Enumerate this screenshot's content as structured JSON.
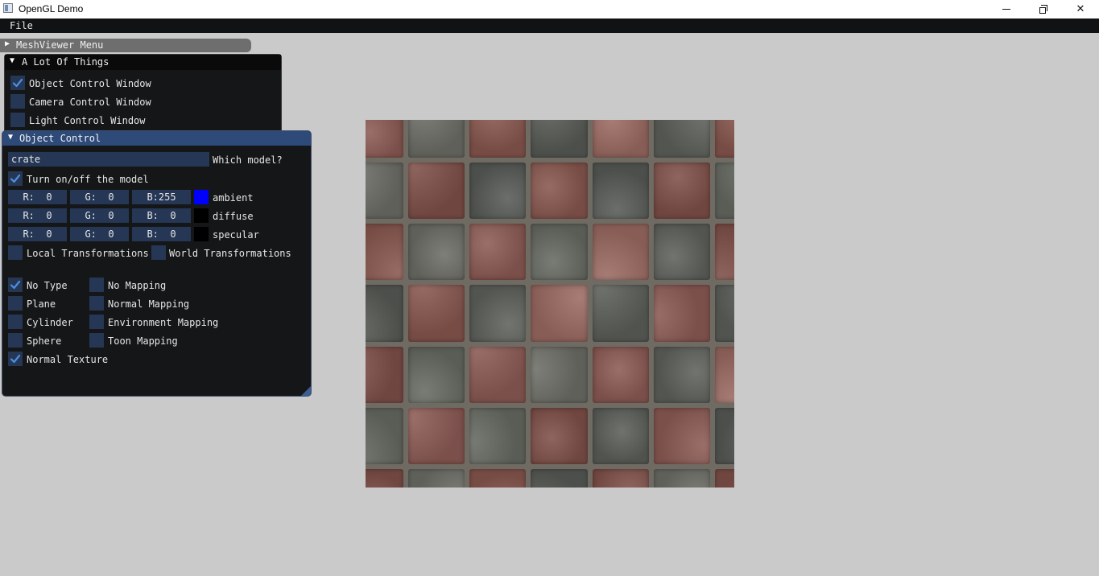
{
  "window": {
    "title": "OpenGL Demo",
    "icon": "app-window-icon",
    "controls": {
      "minimize": "minimize-icon",
      "maximize": "restore-icon",
      "close_glyph": "✕"
    }
  },
  "menubar": {
    "file": "File"
  },
  "meshviewer_menu": {
    "arrow": "▶",
    "label": "MeshViewer Menu"
  },
  "things_window": {
    "arrow": "▼",
    "title": "A Lot Of Things",
    "items": [
      {
        "label": "Object Control Window",
        "checked": true
      },
      {
        "label": "Camera Control Window",
        "checked": false
      },
      {
        "label": "Light Control Window",
        "checked": false
      }
    ]
  },
  "object_control": {
    "arrow": "▼",
    "title": "Object Control",
    "model_value": "crate",
    "model_label": "Which model?",
    "turn_on": {
      "label": "Turn on/off the model",
      "checked": true
    },
    "materials": [
      {
        "r": "R:  0",
        "g": "G:  0",
        "b": "B:255",
        "swatch": "#0000ff",
        "label": "ambient"
      },
      {
        "r": "R:  0",
        "g": "G:  0",
        "b": "B:  0",
        "swatch": "#000000",
        "label": "diffuse"
      },
      {
        "r": "R:  0",
        "g": "G:  0",
        "b": "B:  0",
        "swatch": "#000000",
        "label": "specular"
      }
    ],
    "local_transformations": {
      "label": "Local Transformations",
      "checked": false
    },
    "world_transformations": {
      "label": "World Transformations",
      "checked": false
    },
    "types": [
      {
        "label": "No Type",
        "checked": true
      },
      {
        "label": "Plane",
        "checked": false
      },
      {
        "label": "Cylinder",
        "checked": false
      },
      {
        "label": "Sphere",
        "checked": false
      },
      {
        "label": "Normal Texture",
        "checked": true
      }
    ],
    "mappings": [
      {
        "label": "No Mapping",
        "checked": false
      },
      {
        "label": "Normal Mapping",
        "checked": false
      },
      {
        "label": "Environment Mapping",
        "checked": false
      },
      {
        "label": "Toon Mapping",
        "checked": false
      }
    ]
  },
  "colors": {
    "window_bg": "#151618",
    "frame_bg": "#253755",
    "title_active": "#2d4a79",
    "check": "#4c8fe0",
    "canvas_bg": "#cacaca"
  },
  "texture": {
    "name": "brick-paving-texture"
  }
}
